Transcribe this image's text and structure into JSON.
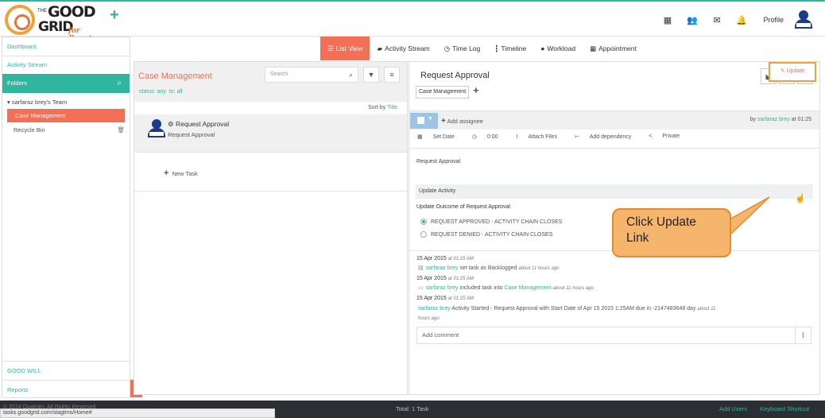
{
  "brand": {
    "line1": "THE GOOD",
    "line1_main": "GOOD",
    "line1_small": "THE",
    "line2": "GRID",
    "tagline": "for Reentry"
  },
  "topbar": {
    "profile_label": "Profile",
    "icons": [
      "apps-grid-icon",
      "users-icon",
      "mail-icon",
      "bell-icon"
    ]
  },
  "sidebar": {
    "dashboard": "Dashboard",
    "activity_stream": "Activity Stream",
    "folders": "Folders",
    "team": "sarfaraz brey's Team",
    "case_management": "Case Management",
    "recycle_bin": "Recycle Bin",
    "good_will": "GOOD WILL",
    "reports": "Reports"
  },
  "view_tabs": [
    {
      "label": "List View",
      "icon": "list-icon",
      "active": true
    },
    {
      "label": "Activity Stream",
      "icon": "chat-icon",
      "active": false
    },
    {
      "label": "Time Log",
      "icon": "clock-icon",
      "active": false
    },
    {
      "label": "Timeline",
      "icon": "timeline-icon",
      "active": false
    },
    {
      "label": "Workload",
      "icon": "person-icon",
      "active": false
    },
    {
      "label": "Appointment",
      "icon": "calendar-icon",
      "active": false
    }
  ],
  "list": {
    "title": "Case Management",
    "status": "status: any",
    "to": "to: all",
    "search_placeholder": "Search",
    "sort_by": "Sort by",
    "sort_field": "Title",
    "task_title": "Request Approval",
    "task_subtitle": "Request Approval",
    "new_task": "New Task"
  },
  "detail": {
    "title": "Request Approval",
    "tag": "Case Management",
    "add_assignee": "Add assignee",
    "by": "by",
    "by_user": "sarfaraz brey",
    "by_time": "at 01:25",
    "actions": [
      "Set Date",
      "0:00",
      "Attach Files",
      "Add dependency",
      "Private"
    ],
    "description": "Request Approval",
    "update_activity": "Update Activity",
    "update_link": "Update",
    "outcome_label": "Update Outcome of Request Approval",
    "options": [
      {
        "label": "REQUEST APPROVED - ACTIVITY CHAIN CLOSES",
        "selected": true
      },
      {
        "label": "REQUEST DENIED - ACTIVITY CHAIN CLOSES",
        "selected": false
      }
    ],
    "history": [
      {
        "date": "15 Apr 2015",
        "time": "at 01:25 AM",
        "user": "sarfaraz brey",
        "text": " set task as Backlogged ",
        "ago": "about 11 hours ago"
      },
      {
        "date": "15 Apr 2015",
        "time": "at 01:25 AM",
        "user": "sarfaraz brey",
        "text": " included task into ",
        "link": "Case Management",
        "ago": "about 11 hours ago"
      },
      {
        "date": "15 Apr 2015",
        "time": "at 01:25 AM",
        "user": "sarfaraz brey",
        "text": " Activity Started - Request Approval with Start Date of Apr 15 2015 1:25AM due in -2147483648 day ",
        "ago": "about 11 hours ago"
      }
    ],
    "comment_placeholder": "Add comment"
  },
  "callout": {
    "text": "Click Update Link"
  },
  "footer": {
    "copyright": "© 2014 Quatrain. All Rights Reserved",
    "total": "Total: 1 Task",
    "add_users": "Add Users",
    "keyboard_shortcut": "Keyboard Shortcut"
  },
  "status_url": "tasks.goodgrid.com/stagtms/Home#",
  "colors": {
    "accent": "#2fb5a0",
    "active": "#f36f55",
    "callout": "#f6b56d"
  }
}
